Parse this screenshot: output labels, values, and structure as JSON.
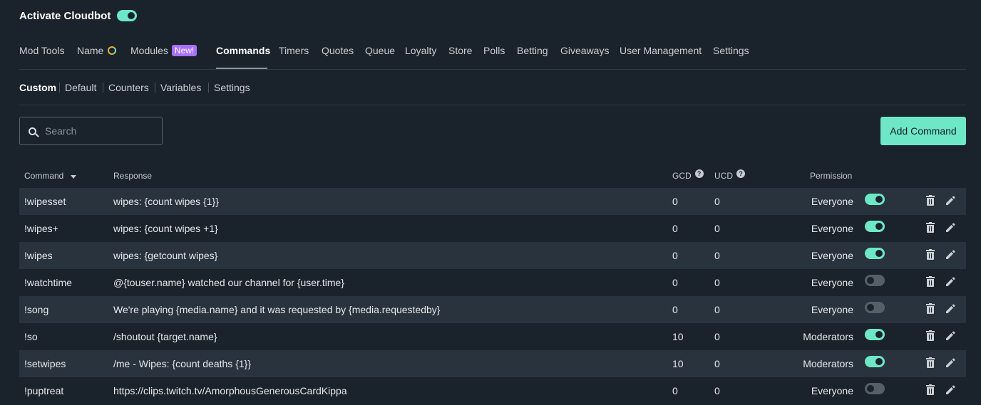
{
  "header": {
    "title": "Activate Cloudbot",
    "toggle_on": true
  },
  "tabs": [
    {
      "label": "Mod Tools",
      "active": false
    },
    {
      "label": "Name",
      "active": false,
      "icon": "loading-icon"
    },
    {
      "label": "Modules",
      "active": false,
      "badge": "New!"
    },
    {
      "label": "Commands",
      "active": true
    },
    {
      "label": "Timers",
      "active": false
    },
    {
      "label": "Quotes",
      "active": false
    },
    {
      "label": "Queue",
      "active": false
    },
    {
      "label": "Loyalty",
      "active": false
    },
    {
      "label": "Store",
      "active": false
    },
    {
      "label": "Polls",
      "active": false
    },
    {
      "label": "Betting",
      "active": false
    },
    {
      "label": "Giveaways",
      "active": false
    },
    {
      "label": "User Management",
      "active": false
    },
    {
      "label": "Settings",
      "active": false
    }
  ],
  "subtabs": [
    {
      "label": "Custom",
      "active": true
    },
    {
      "label": "Default",
      "active": false
    },
    {
      "label": "Counters",
      "active": false
    },
    {
      "label": "Variables",
      "active": false
    },
    {
      "label": "Settings",
      "active": false
    }
  ],
  "search": {
    "placeholder": "Search",
    "value": ""
  },
  "add_button": "Add Command",
  "table": {
    "headers": {
      "command": "Command",
      "response": "Response",
      "gcd": "GCD",
      "ucd": "UCD",
      "permission": "Permission"
    },
    "help_glyph": "?",
    "rows": [
      {
        "command": "!wipesset",
        "response": "wipes: {count wipes {1}}",
        "gcd": "0",
        "ucd": "0",
        "permission": "Everyone",
        "enabled": true
      },
      {
        "command": "!wipes+",
        "response": "wipes: {count wipes +1}",
        "gcd": "0",
        "ucd": "0",
        "permission": "Everyone",
        "enabled": true
      },
      {
        "command": "!wipes",
        "response": "wipes: {getcount wipes}",
        "gcd": "0",
        "ucd": "0",
        "permission": "Everyone",
        "enabled": true
      },
      {
        "command": "!watchtime",
        "response": "@{touser.name} watched our channel for {user.time}",
        "gcd": "0",
        "ucd": "0",
        "permission": "Everyone",
        "enabled": false
      },
      {
        "command": "!song",
        "response": "We're playing {media.name} and it was requested by {media.requestedby}",
        "gcd": "0",
        "ucd": "0",
        "permission": "Everyone",
        "enabled": false
      },
      {
        "command": "!so",
        "response": "/shoutout {target.name}",
        "gcd": "10",
        "ucd": "0",
        "permission": "Moderators",
        "enabled": true
      },
      {
        "command": "!setwipes",
        "response": "/me - Wipes: {count deaths {1}}",
        "gcd": "10",
        "ucd": "0",
        "permission": "Moderators",
        "enabled": true
      },
      {
        "command": "!puptreat",
        "response": "https://clips.twitch.tv/AmorphousGenerousCardKippa",
        "gcd": "0",
        "ucd": "0",
        "permission": "Everyone",
        "enabled": false
      }
    ]
  },
  "colors": {
    "accent": "#6ee7c7",
    "background": "#1a232c",
    "row_alt": "#29333d",
    "badge": "#a970ff"
  }
}
